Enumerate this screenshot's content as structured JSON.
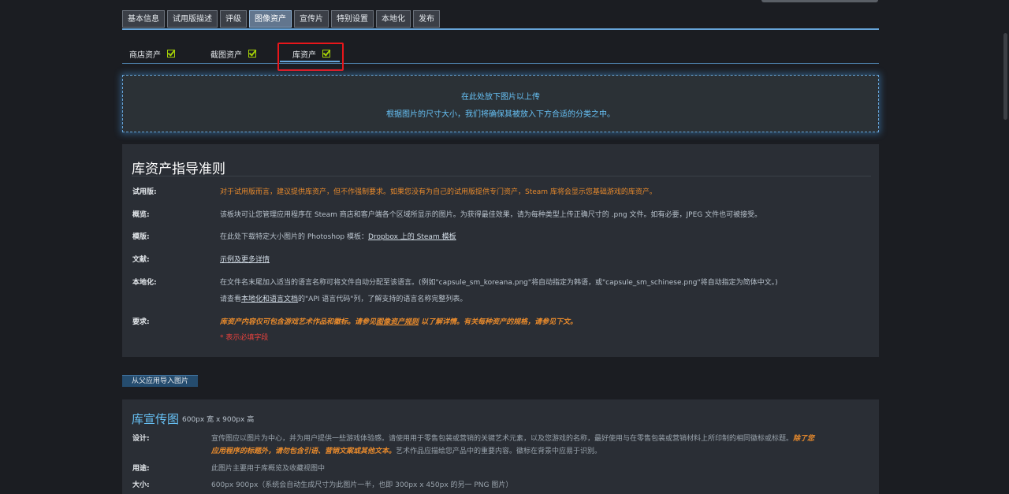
{
  "main_tabs": [
    "基本信息",
    "试用版描述",
    "评级",
    "图像资产",
    "宣传片",
    "特别设置",
    "本地化",
    "发布"
  ],
  "main_tabs_active": "图像资产",
  "sub_tabs": [
    "商店资产",
    "截图资产",
    "库资产"
  ],
  "sub_tabs_active": "库资产",
  "dropzone": {
    "line1": "在此处放下图片以上传",
    "line2": "根据图片的尺寸大小，我们将确保其被放入下方合适的分类之中。"
  },
  "guidelines": {
    "title": "库资产指导准则",
    "trial_label": "试用版:",
    "trial_text": "对于试用版而言，建议提供库资产，但不作强制要求。如果您没有为自己的试用版提供专门资产，Steam 库将会显示您基础游戏的库资产。",
    "overview_label": "概览:",
    "overview_text": "该板块可让您管理应用程序在 Steam 商店和客户端各个区域所显示的图片。为获得最佳效果，请为每种类型上传正确尺寸的 .png 文件。如有必要，JPEG 文件也可被接受。",
    "template_label": "模版:",
    "template_text": "在此处下载特定大小图片的 Photoshop 模板：",
    "template_link": "Dropbox 上的 Steam 模板",
    "docs_label": "文献:",
    "docs_link": "示例及更多详情",
    "loc_label": "本地化:",
    "loc_text1": "在文件名末尾加入适当的语言名称可将文件自动分配至该语言。(例如\"capsule_sm_koreana.png\"将自动指定为韩语，或\"capsule_sm_schinese.png\"将自动指定为简体中文。)",
    "loc_text2_pre": "请查看",
    "loc_text2_link": "本地化和语言文档",
    "loc_text2_post": "的\"API 语言代码\"列，了解支持的语言名称完整列表。",
    "req_label": "要求:",
    "req_text_pre": "库资产内容仅可包含游戏艺术作品和徽标。请参见",
    "req_text_link": "图像资产规则",
    "req_text_post": " 以了解详情。有关每种资产的规格，请参见下文。",
    "required_note": "* 表示必填字段"
  },
  "import_button": "从父应用导入图片",
  "capsule": {
    "title": "库宣传图",
    "dims": "600px 宽 x 900px 高",
    "design_label": "设计:",
    "design_text1_pre": "宣传图应以图片为中心，并为用户提供一些游戏体验感。请使用用于零售包装或营销的关键艺术元素，以及您游戏的名称，最好使用与在零售包装或营销材料上所印制的相同徽标或标题。",
    "design_text1_em": "除了您",
    "design_text2_em": "应用程序的标题外，请勿包含引语、营销文案或其他文本。",
    "design_text2_post": "艺术作品应描绘您产品中的重要内容。徽标在背景中应易于识别。",
    "usage_label": "用途:",
    "usage_text": "此图片主要用于库概览及收藏视图中",
    "size_label": "大小:",
    "size_text": "600px 900px（系统会自动生成尺寸为此图片一半，也即 300px x 450px 的另一 PNG 图片）"
  }
}
